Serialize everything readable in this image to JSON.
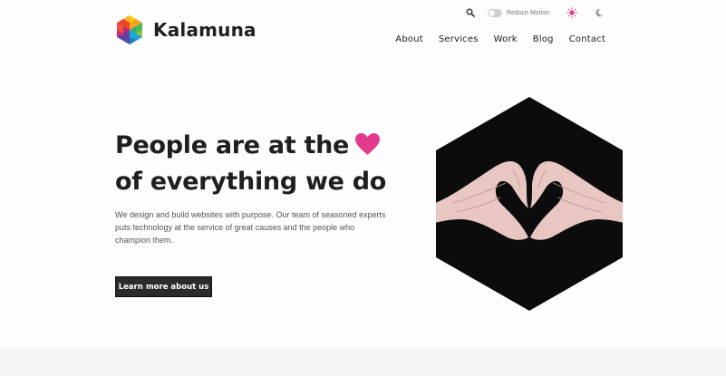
{
  "brand": {
    "name": "Kalamuna",
    "logo_icon": "hexagon-cube-logo"
  },
  "utility": {
    "search_icon": "search-icon",
    "reduce_motion_label": "Reduce Motion",
    "light_theme_icon": "sun-icon",
    "dark_theme_icon": "moon-icon"
  },
  "nav": {
    "items": [
      {
        "label": "About"
      },
      {
        "label": "Services"
      },
      {
        "label": "Work"
      },
      {
        "label": "Blog"
      },
      {
        "label": "Contact"
      }
    ]
  },
  "hero": {
    "title_line1": "People are at the",
    "title_line2": "of everything we do",
    "heart_icon": "heart-icon",
    "description": "We design and build websites with purpose. Our team of seasoned experts puts technology at the service of great causes and the people who champion them.",
    "cta_label": "Learn more about us",
    "image": "heart-hands-photo"
  },
  "colors": {
    "accent_pink": "#e23a8d",
    "button_bg": "#2b2b2b",
    "text_dark": "#1f1f1f",
    "text_muted": "#555555"
  }
}
